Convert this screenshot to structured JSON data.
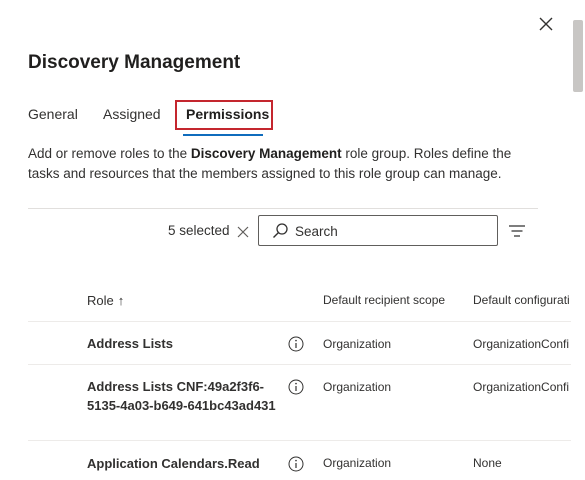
{
  "panel": {
    "title": "Discovery Management"
  },
  "tabs": [
    {
      "label": "General"
    },
    {
      "label": "Assigned"
    },
    {
      "label": "Permissions",
      "selected": true
    }
  ],
  "description": {
    "prefix": "Add or remove roles to the ",
    "bold": "Discovery Management",
    "suffix": " role group. Roles define the tasks and resources that the members assigned to this role group can manage."
  },
  "toolbar": {
    "selected_count": "5 selected",
    "search_placeholder": "Search"
  },
  "table": {
    "columns": {
      "role": "Role",
      "scope": "Default recipient scope",
      "config": "Default configurati"
    },
    "rows": [
      {
        "role": "Address Lists",
        "scope": "Organization",
        "config": "OrganizationConfi"
      },
      {
        "role": "Address Lists CNF:49a2f3f6-5135-4a03-b649-641bc43ad431",
        "scope": "Organization",
        "config": "OrganizationConfi"
      },
      {
        "role": "Application Calendars.Read",
        "scope": "Organization",
        "config": "None"
      }
    ]
  },
  "colors": {
    "accent": "#0f6cbd",
    "highlight_box": "#c4262e"
  }
}
